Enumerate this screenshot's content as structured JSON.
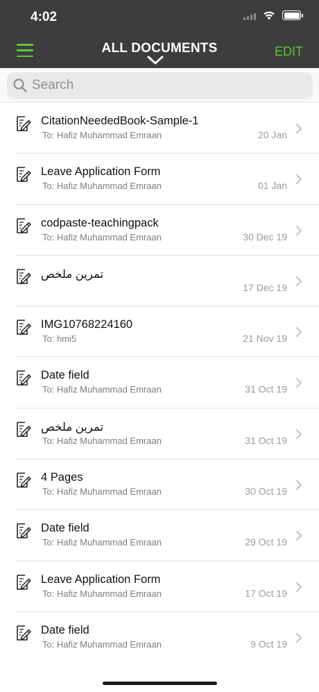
{
  "status": {
    "time": "4:02"
  },
  "header": {
    "title": "ALL DOCUMENTS",
    "edit_label": "EDIT"
  },
  "search": {
    "placeholder": "Search",
    "value": ""
  },
  "colors": {
    "accent": "#5cc93a",
    "header_bg": "#3d3d3d"
  },
  "icons": {
    "menu": "hamburger-icon",
    "title_toggle": "chevron-down-icon",
    "search": "search-icon",
    "document": "document-edit-icon",
    "row_arrow": "chevron-right-icon"
  },
  "documents": [
    {
      "title": "CitationNeededBook-Sample-1",
      "to": "To: Hafiz Muhammad Emraan",
      "date": "20 Jan"
    },
    {
      "title": "Leave Application Form",
      "to": "To: Hafiz Muhammad Emraan",
      "date": "01 Jan"
    },
    {
      "title": "codpaste-teachingpack",
      "to": "To: Hafiz Muhammad Emraan",
      "date": "30 Dec 19"
    },
    {
      "title": "تمرين ملخص",
      "to": "",
      "date": "17 Dec 19"
    },
    {
      "title": "IMG10768224160",
      "to": "To: hmi5",
      "date": "21 Nov 19"
    },
    {
      "title": "Date field",
      "to": "To: Hafiz Muhammad Emraan",
      "date": "31 Oct 19"
    },
    {
      "title": "تمرين ملخص",
      "to": "To: Hafiz Muhammad Emraan",
      "date": "31 Oct 19"
    },
    {
      "title": "4 Pages",
      "to": "To: Hafiz Muhammad Emraan",
      "date": "30 Oct 19"
    },
    {
      "title": "Date field",
      "to": "To: Hafiz Muhammad Emraan",
      "date": "29 Oct 19"
    },
    {
      "title": "Leave Application Form",
      "to": "To: Hafiz Muhammad Emraan",
      "date": "17 Oct 19"
    },
    {
      "title": "Date field",
      "to": "To: Hafiz Muhammad Emraan",
      "date": "9 Oct 19"
    }
  ]
}
